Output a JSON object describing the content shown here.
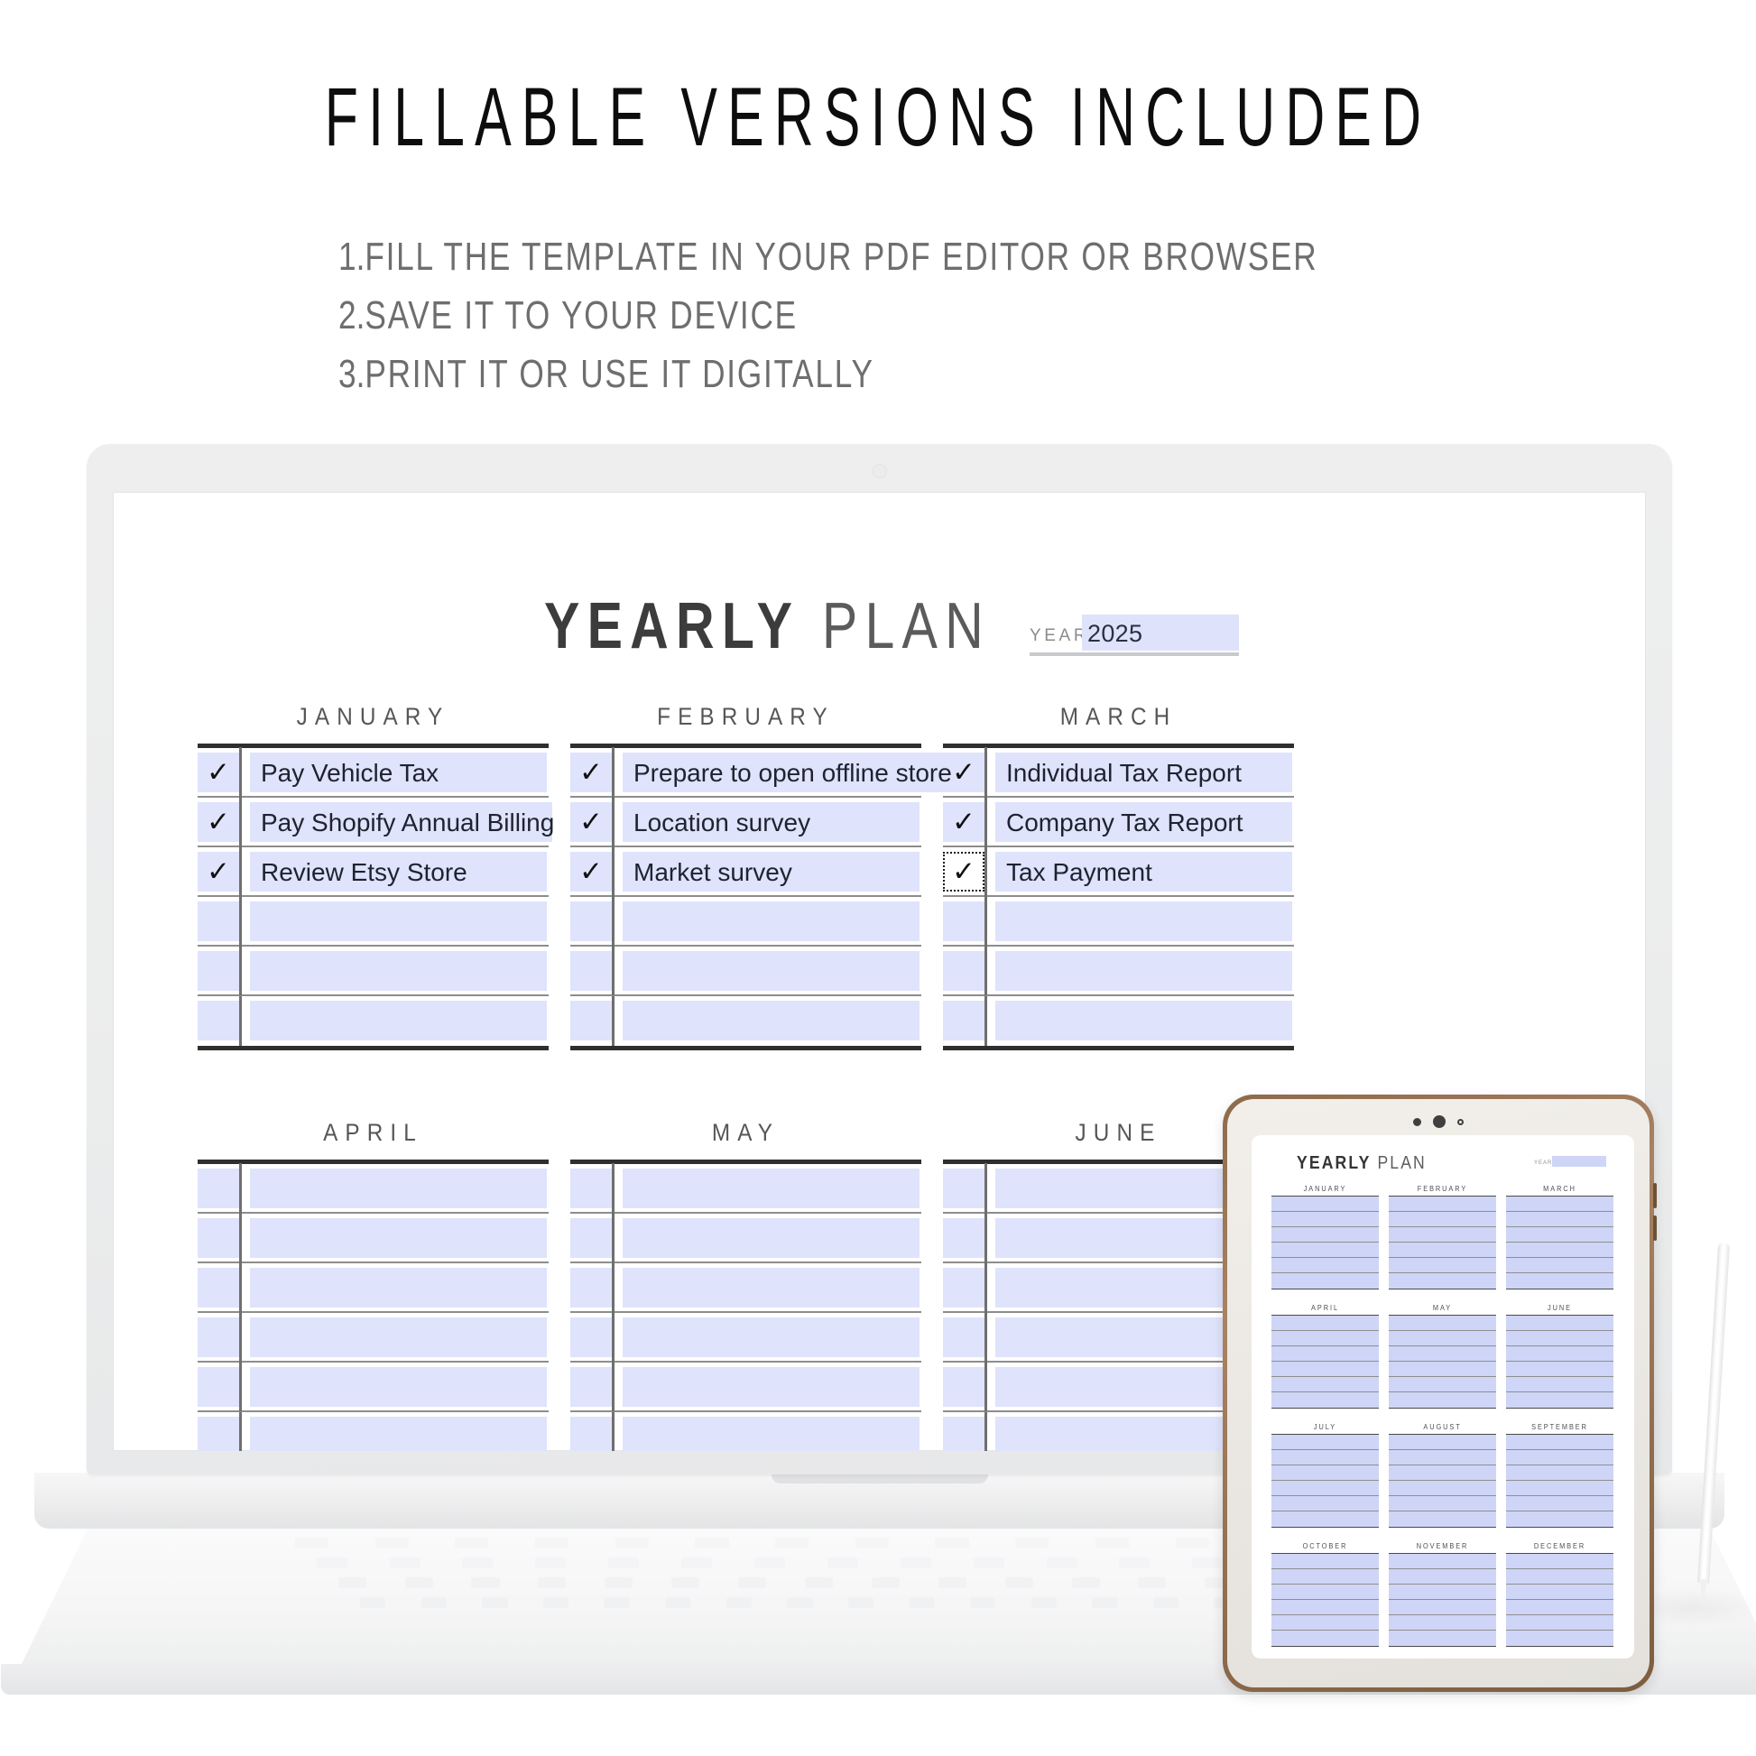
{
  "promo": {
    "headline": "FILLABLE VERSIONS INCLUDED",
    "steps": [
      {
        "num": "1.",
        "text": "FILL THE TEMPLATE IN YOUR PDF EDITOR OR BROWSER"
      },
      {
        "num": "2.",
        "text": "SAVE IT TO YOUR DEVICE"
      },
      {
        "num": "3.",
        "text": "PRINT IT OR USE IT DIGITALLY"
      }
    ]
  },
  "colors": {
    "field_fill": "#dfe3fb",
    "field_fill_tablet": "#ced5f6",
    "rule_dark": "#2f2f2f",
    "rule_light": "#8d8d8d",
    "text_dark": "#1d2330",
    "month_label": "#565656",
    "tablet_frame": "#8e6c4c",
    "laptop_body": "#ecedee"
  },
  "planner": {
    "title_bold": "YEARLY",
    "title_light": "PLAN",
    "year_label": "YEAR:",
    "year_value": "2025",
    "rows_per_month": 6,
    "months": [
      {
        "name": "JANUARY",
        "tasks": [
          {
            "checked": true,
            "check": "✓",
            "text": "Pay Vehicle Tax",
            "focused": false
          },
          {
            "checked": true,
            "check": "✓",
            "text": "Pay Shopify Annual Billing",
            "focused": false
          },
          {
            "checked": true,
            "check": "✓",
            "text": "Review Etsy Store",
            "focused": false
          },
          {
            "checked": false,
            "check": "",
            "text": "",
            "focused": false
          },
          {
            "checked": false,
            "check": "",
            "text": "",
            "focused": false
          },
          {
            "checked": false,
            "check": "",
            "text": "",
            "focused": false
          }
        ]
      },
      {
        "name": "FEBRUARY",
        "tasks": [
          {
            "checked": true,
            "check": "✓",
            "text": "Prepare to open offline store",
            "focused": false
          },
          {
            "checked": true,
            "check": "✓",
            "text": "Location survey",
            "focused": false
          },
          {
            "checked": true,
            "check": "✓",
            "text": "Market survey",
            "focused": false
          },
          {
            "checked": false,
            "check": "",
            "text": "",
            "focused": false
          },
          {
            "checked": false,
            "check": "",
            "text": "",
            "focused": false
          },
          {
            "checked": false,
            "check": "",
            "text": "",
            "focused": false
          }
        ]
      },
      {
        "name": "MARCH",
        "tasks": [
          {
            "checked": true,
            "check": "✓",
            "text": "Individual Tax Report",
            "focused": false
          },
          {
            "checked": true,
            "check": "✓",
            "text": "Company Tax Report",
            "focused": false
          },
          {
            "checked": true,
            "check": "✓",
            "text": "Tax Payment",
            "focused": true
          },
          {
            "checked": false,
            "check": "",
            "text": "",
            "focused": false
          },
          {
            "checked": false,
            "check": "",
            "text": "",
            "focused": false
          },
          {
            "checked": false,
            "check": "",
            "text": "",
            "focused": false
          }
        ]
      },
      {
        "name": "APRIL",
        "tasks": [
          {
            "checked": false,
            "check": "",
            "text": "",
            "focused": false
          },
          {
            "checked": false,
            "check": "",
            "text": "",
            "focused": false
          },
          {
            "checked": false,
            "check": "",
            "text": "",
            "focused": false
          },
          {
            "checked": false,
            "check": "",
            "text": "",
            "focused": false
          },
          {
            "checked": false,
            "check": "",
            "text": "",
            "focused": false
          },
          {
            "checked": false,
            "check": "",
            "text": "",
            "focused": false
          }
        ]
      },
      {
        "name": "MAY",
        "tasks": [
          {
            "checked": false,
            "check": "",
            "text": "",
            "focused": false
          },
          {
            "checked": false,
            "check": "",
            "text": "",
            "focused": false
          },
          {
            "checked": false,
            "check": "",
            "text": "",
            "focused": false
          },
          {
            "checked": false,
            "check": "",
            "text": "",
            "focused": false
          },
          {
            "checked": false,
            "check": "",
            "text": "",
            "focused": false
          },
          {
            "checked": false,
            "check": "",
            "text": "",
            "focused": false
          }
        ]
      },
      {
        "name": "JUNE",
        "tasks": [
          {
            "checked": false,
            "check": "",
            "text": "",
            "focused": false
          },
          {
            "checked": false,
            "check": "",
            "text": "",
            "focused": false
          },
          {
            "checked": false,
            "check": "",
            "text": "",
            "focused": false
          },
          {
            "checked": false,
            "check": "",
            "text": "",
            "focused": false
          },
          {
            "checked": false,
            "check": "",
            "text": "",
            "focused": false
          },
          {
            "checked": false,
            "check": "",
            "text": "",
            "focused": false
          }
        ]
      }
    ]
  },
  "tablet": {
    "title_bold": "YEARLY",
    "title_light": "PLAN",
    "year_label": "YEAR",
    "year_value": "",
    "lines_per_month": 6,
    "months": [
      "JANUARY",
      "FEBRUARY",
      "MARCH",
      "APRIL",
      "MAY",
      "JUNE",
      "JULY",
      "AUGUST",
      "SEPTEMBER",
      "OCTOBER",
      "NOVEMBER",
      "DECEMBER"
    ]
  }
}
